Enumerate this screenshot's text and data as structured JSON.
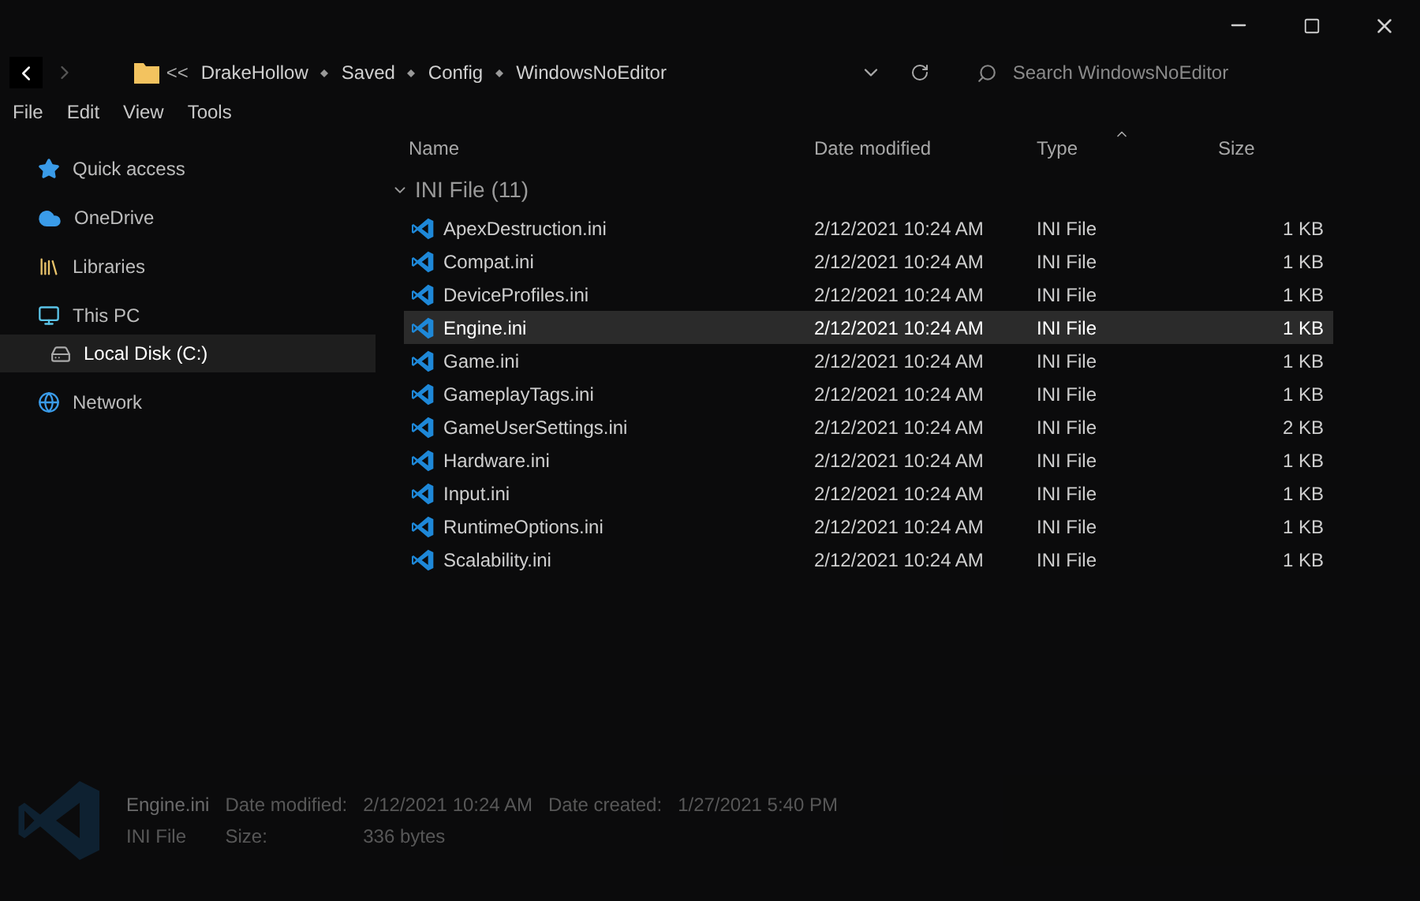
{
  "breadcrumb": {
    "overflow": "<<",
    "parts": [
      "DrakeHollow",
      "Saved",
      "Config",
      "WindowsNoEditor"
    ]
  },
  "search": {
    "placeholder": "Search WindowsNoEditor"
  },
  "menu": [
    "File",
    "Edit",
    "View",
    "Tools"
  ],
  "sidebar": {
    "items": [
      {
        "label": "Quick access",
        "kind": "star",
        "selected": false
      },
      {
        "label": "OneDrive",
        "kind": "cloud",
        "selected": false
      },
      {
        "label": "Libraries",
        "kind": "library",
        "selected": false
      },
      {
        "label": "This PC",
        "kind": "pc",
        "selected": false,
        "children": [
          {
            "label": "Local Disk (C:)",
            "kind": "disk",
            "selected": true
          }
        ]
      },
      {
        "label": "Network",
        "kind": "network",
        "selected": false
      }
    ]
  },
  "table": {
    "columns": [
      "Name",
      "Date modified",
      "Type",
      "Size"
    ],
    "group": "INI File (11)",
    "group_expanded": true,
    "rows": [
      {
        "name": "ApexDestruction.ini",
        "date": "2/12/2021 10:24 AM",
        "type": "INI File",
        "size": "1 KB",
        "selected": false
      },
      {
        "name": "Compat.ini",
        "date": "2/12/2021 10:24 AM",
        "type": "INI File",
        "size": "1 KB",
        "selected": false
      },
      {
        "name": "DeviceProfiles.ini",
        "date": "2/12/2021 10:24 AM",
        "type": "INI File",
        "size": "1 KB",
        "selected": false
      },
      {
        "name": "Engine.ini",
        "date": "2/12/2021 10:24 AM",
        "type": "INI File",
        "size": "1 KB",
        "selected": true
      },
      {
        "name": "Game.ini",
        "date": "2/12/2021 10:24 AM",
        "type": "INI File",
        "size": "1 KB",
        "selected": false
      },
      {
        "name": "GameplayTags.ini",
        "date": "2/12/2021 10:24 AM",
        "type": "INI File",
        "size": "1 KB",
        "selected": false
      },
      {
        "name": "GameUserSettings.ini",
        "date": "2/12/2021 10:24 AM",
        "type": "INI File",
        "size": "2 KB",
        "selected": false
      },
      {
        "name": "Hardware.ini",
        "date": "2/12/2021 10:24 AM",
        "type": "INI File",
        "size": "1 KB",
        "selected": false
      },
      {
        "name": "Input.ini",
        "date": "2/12/2021 10:24 AM",
        "type": "INI File",
        "size": "1 KB",
        "selected": false
      },
      {
        "name": "RuntimeOptions.ini",
        "date": "2/12/2021 10:24 AM",
        "type": "INI File",
        "size": "1 KB",
        "selected": false
      },
      {
        "name": "Scalability.ini",
        "date": "2/12/2021 10:24 AM",
        "type": "INI File",
        "size": "1 KB",
        "selected": false
      }
    ]
  },
  "details": {
    "name": "Engine.ini",
    "type": "INI File",
    "fields": [
      {
        "label": "Date modified:",
        "value": "2/12/2021 10:24 AM"
      },
      {
        "label": "Date created:",
        "value": "1/27/2021 5:40 PM"
      },
      {
        "label": "Size:",
        "value": "336 bytes"
      }
    ]
  }
}
